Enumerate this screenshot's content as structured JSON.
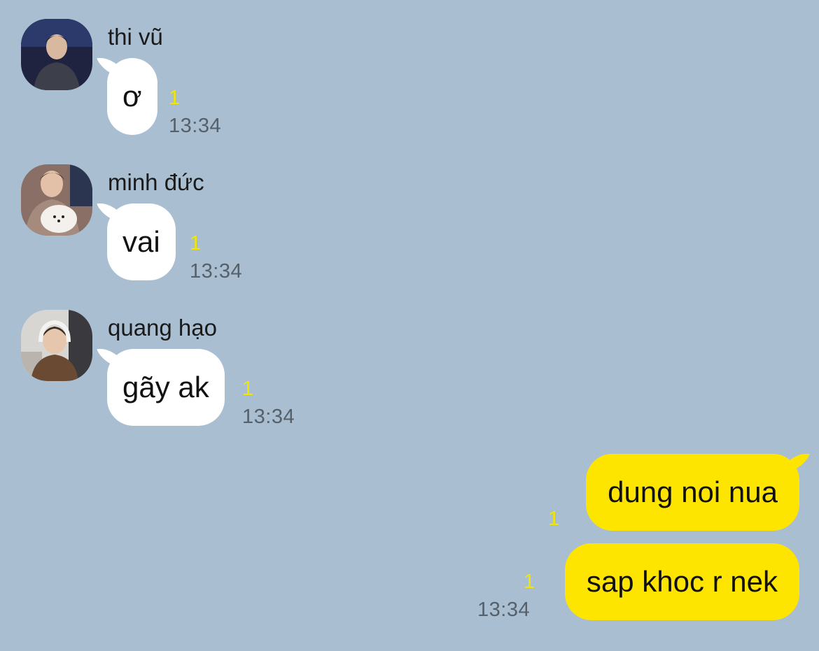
{
  "colors": {
    "background": "#a9bfd1",
    "incoming_bubble": "#ffffff",
    "outgoing_bubble": "#fee500",
    "unread_indicator": "#f2e600",
    "timestamp": "#55606b"
  },
  "messages": [
    {
      "sender": "thi vũ",
      "avatar_icon": "user-avatar-photo",
      "text": "ơ",
      "unread": "1",
      "time": "13:34"
    },
    {
      "sender": "minh đức",
      "avatar_icon": "user-avatar-photo-with-dog",
      "text": "vai",
      "unread": "1",
      "time": "13:34"
    },
    {
      "sender": "quang hạo",
      "avatar_icon": "user-avatar-photo-headphones",
      "text": "gãy ak",
      "unread": "1",
      "time": "13:34"
    }
  ],
  "my_messages": [
    {
      "text": "dung noi nua",
      "unread": "1"
    },
    {
      "text": "sap khoc r nek",
      "unread": "1",
      "time": "13:34"
    }
  ]
}
